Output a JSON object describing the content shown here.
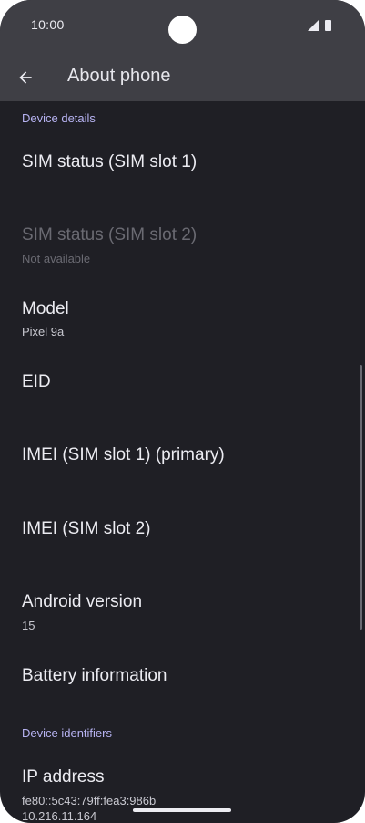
{
  "status_bar": {
    "time": "10:00"
  },
  "app_bar": {
    "title": "About phone",
    "back_icon": "arrow-back-icon"
  },
  "sections": [
    {
      "header": "Device details",
      "rows": [
        {
          "title": "SIM status (SIM slot 1)",
          "summary": ""
        },
        {
          "title": "SIM status (SIM slot 2)",
          "summary": "Not available",
          "disabled": true
        },
        {
          "title": "Model",
          "summary": "Pixel 9a"
        },
        {
          "title": "EID",
          "summary": ""
        },
        {
          "title": "IMEI (SIM slot 1) (primary)",
          "summary": ""
        },
        {
          "title": "IMEI (SIM slot 2)",
          "summary": ""
        },
        {
          "title": "Android version",
          "summary": "15"
        },
        {
          "title": "Battery information",
          "summary": ""
        }
      ]
    },
    {
      "header": "Device identifiers",
      "rows": [
        {
          "title": "IP address",
          "summary_lines": [
            "fe80::5c43:79ff:fea3:986b",
            "10.216.11.164"
          ]
        }
      ]
    }
  ],
  "colors": {
    "background": "#1f1f25",
    "app_bar": "#3f3f45",
    "section_header": "#b7b3f2",
    "text_primary": "#ececf2",
    "text_disabled": "#6a6a72"
  }
}
